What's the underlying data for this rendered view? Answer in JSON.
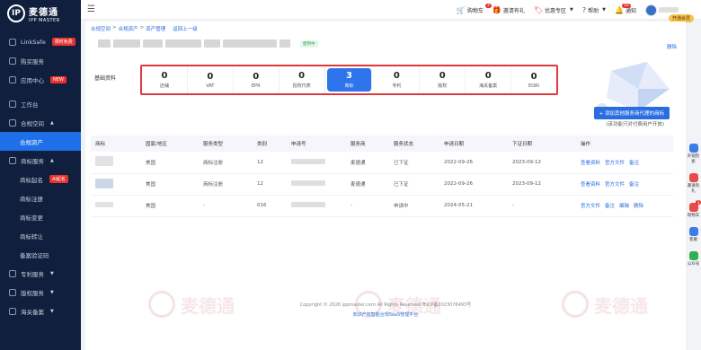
{
  "brand": {
    "name_cn": "麦德通",
    "name_en": "IPP MASTER"
  },
  "sidebar": {
    "items": [
      {
        "label": "LinkSafe",
        "badge": "限时免费"
      },
      {
        "label": "购买服务"
      },
      {
        "label": "应用中心",
        "badge": "NEW"
      },
      {
        "label": "工作台"
      },
      {
        "label": "合规空间"
      },
      {
        "label": "合规资产"
      },
      {
        "label": "商标服务"
      },
      {
        "label": "商标起名",
        "badge": "AI起名"
      },
      {
        "label": "商标注册"
      },
      {
        "label": "商标变更"
      },
      {
        "label": "商标转让"
      },
      {
        "label": "备案验证码"
      },
      {
        "label": "专利服务"
      },
      {
        "label": "版权服务"
      },
      {
        "label": "海关备案"
      }
    ]
  },
  "topbar": {
    "cart_label": "购物车",
    "cart_count": "3",
    "invite_label": "邀请有礼",
    "discount_label": "优惠专区",
    "help_label": "帮助",
    "notify_label": "通知",
    "notify_count": "10",
    "vip_label": "开通会员"
  },
  "breadcrumb": {
    "items": [
      "合规空间",
      "合规资产",
      "资产管理"
    ],
    "back": "返回上一级"
  },
  "header": {
    "status": "使用中",
    "delete": "删除"
  },
  "tabs": {
    "label": "基础资料",
    "items": [
      {
        "value": "0",
        "label": "店铺"
      },
      {
        "value": "0",
        "label": "VAT"
      },
      {
        "value": "0",
        "label": "EPR"
      },
      {
        "value": "0",
        "label": "授权代表"
      },
      {
        "value": "3",
        "label": "商标"
      },
      {
        "value": "0",
        "label": "专利"
      },
      {
        "value": "0",
        "label": "版权"
      },
      {
        "value": "0",
        "label": "海关备案"
      },
      {
        "value": "0",
        "label": "EORI"
      }
    ]
  },
  "actions": {
    "add_button": "+ 添加其他服务商代理的商标",
    "hint": "(该功能只对付费用户开放)"
  },
  "table": {
    "headers": [
      "商标",
      "国家/地区",
      "服务类型",
      "类别",
      "申请号",
      "服务商",
      "服务状态",
      "申请日期",
      "下证日期",
      "操作"
    ],
    "rows": [
      {
        "country": "美国",
        "service": "商标注册",
        "class": "12",
        "provider": "麦德通",
        "status": "已下证",
        "apply_date": "2022-09-26",
        "cert_date": "2023-09-12",
        "ops": [
          "查看资料",
          "官方文件",
          "备注"
        ]
      },
      {
        "country": "美国",
        "service": "商标注册",
        "class": "12",
        "provider": "麦德通",
        "status": "已下证",
        "apply_date": "2022-09-26",
        "cert_date": "2023-09-12",
        "ops": [
          "查看资料",
          "官方文件",
          "备注"
        ]
      },
      {
        "country": "美国",
        "service": "-",
        "class": "016",
        "provider": "-",
        "status": "申请中",
        "apply_date": "2024-05-21",
        "cert_date": "-",
        "ops": [
          "官方文件",
          "备注",
          "编辑",
          "删除"
        ]
      }
    ]
  },
  "footer": {
    "copyright": "Copyright © 2026 ippmaster.com All Rights Reserved 粤ICP备2023076493号",
    "sub": "知识产权智能合规SaaS管理平台"
  },
  "rail": [
    {
      "label": "外观检索"
    },
    {
      "label": "邀请有礼"
    },
    {
      "label": "购物车",
      "badge": "3"
    },
    {
      "label": "客服"
    },
    {
      "label": "公众号"
    }
  ]
}
